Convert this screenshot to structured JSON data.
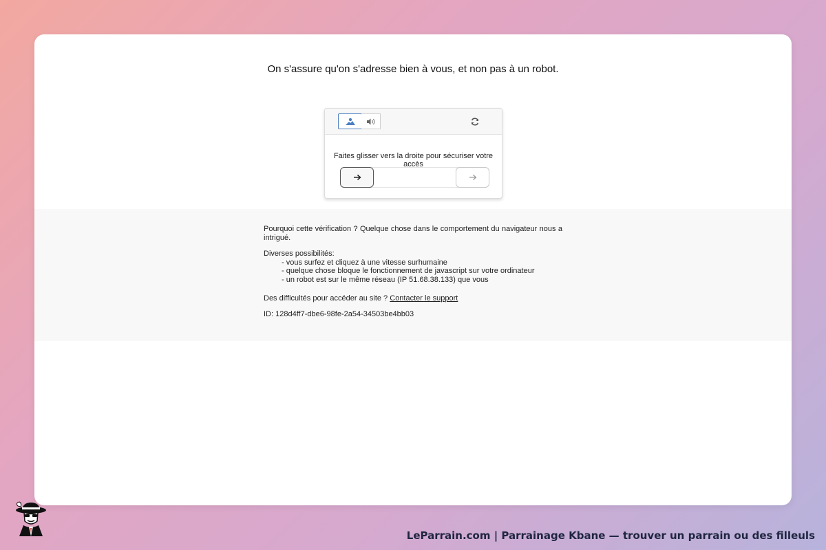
{
  "page": {
    "headline": "On s'assure qu'on s'adresse bien à vous, et non pas à un robot."
  },
  "captcha": {
    "mode_image_icon": "image-icon",
    "mode_audio_icon": "speaker-icon",
    "refresh_icon": "refresh-icon",
    "instruction": "Faites glisser vers la droite pour sécuriser votre accès",
    "slider_handle_icon": "arrow-right-icon",
    "slider_target_icon": "arrow-right-icon",
    "accent_color": "#4a7fc0"
  },
  "info": {
    "why": "Pourquoi cette vérification ? Quelque chose dans le comportement du navigateur nous a intrigué.",
    "possibilities_title": "Diverses possibilités:",
    "possibilities": [
      "- vous surfez et cliquez à une vitesse surhumaine",
      "- quelque chose bloque le fonctionnement de javascript sur votre ordinateur",
      "- un robot est sur le même réseau (IP 51.68.38.133) que vous"
    ],
    "help_prefix": "Des difficultés pour accéder au site ?",
    "help_link": "Contacter le support",
    "id_line": "ID: 128d4ff7-dbe6-98fe-2a54-34503be4bb03"
  },
  "footer": {
    "logo_icon": "gangster-logo-icon",
    "title": "LeParrain.com | Parrainage Kbane — trouver un parrain ou des filleuls"
  }
}
